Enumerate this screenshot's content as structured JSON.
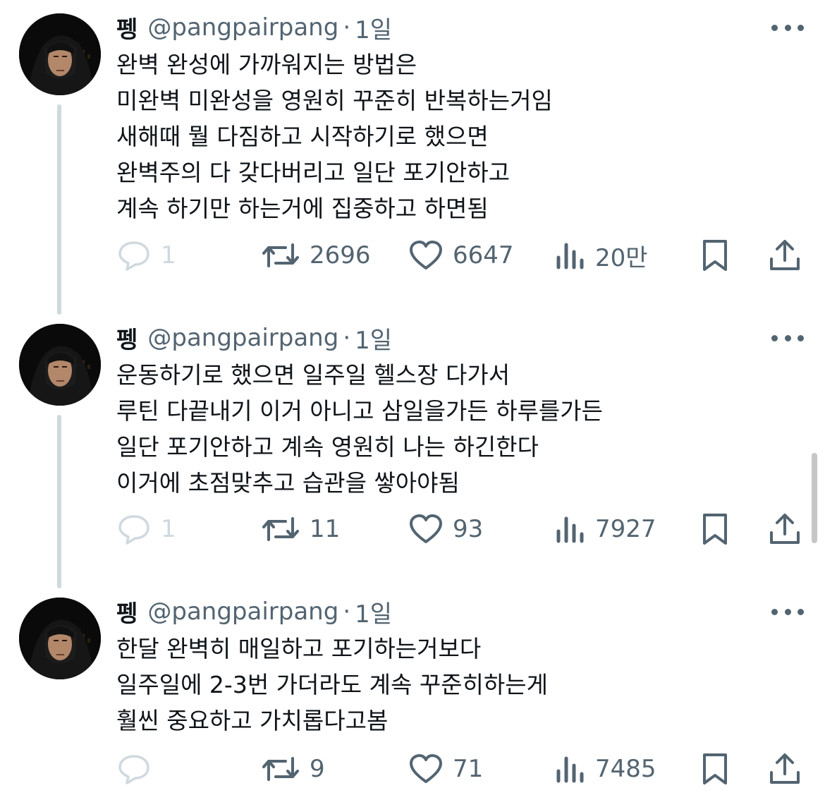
{
  "tweets": [
    {
      "name": "펭",
      "handle": "@pangpairpang",
      "dot": "·",
      "time": "1일",
      "lines": [
        "완벽 완성에 가까워지는 방법은",
        "미완벽 미완성을 영원히 꾸준히 반복하는거임",
        "새해때 뭘 다짐하고 시작하기로 했으면",
        "완벽주의 다 갖다버리고 일단 포기안하고",
        "계속 하기만 하는거에 집중하고 하면됨"
      ],
      "replies": "1",
      "retweets": "2696",
      "likes": "6647",
      "views": "20만"
    },
    {
      "name": "펭",
      "handle": "@pangpairpang",
      "dot": "·",
      "time": "1일",
      "lines": [
        "운동하기로 했으면 일주일 헬스장 다가서",
        "루틴 다끝내기 이거 아니고 삼일을가든 하루를가든",
        "일단 포기안하고 계속 영원히 나는 하긴한다",
        "이거에 초점맞추고 습관을 쌓아야됨"
      ],
      "replies": "1",
      "retweets": "11",
      "likes": "93",
      "views": "7927"
    },
    {
      "name": "펭",
      "handle": "@pangpairpang",
      "dot": "·",
      "time": "1일",
      "lines": [
        "한달 완벽히 매일하고 포기하는거보다",
        "일주일에 2-3번 가더라도 계속 꾸준히하는게",
        "훨씬 중요하고 가치롭다고봄"
      ],
      "replies": "",
      "retweets": "9",
      "likes": "71",
      "views": "7485"
    }
  ],
  "icons": {
    "reply": "reply-icon",
    "retweet": "retweet-icon",
    "like": "heart-icon",
    "views": "views-icon",
    "bookmark": "bookmark-icon",
    "share": "share-icon",
    "more": "more-icon"
  },
  "colors": {
    "text": "#0f1419",
    "secondary": "#536471",
    "thread_line": "#cfd9de"
  }
}
